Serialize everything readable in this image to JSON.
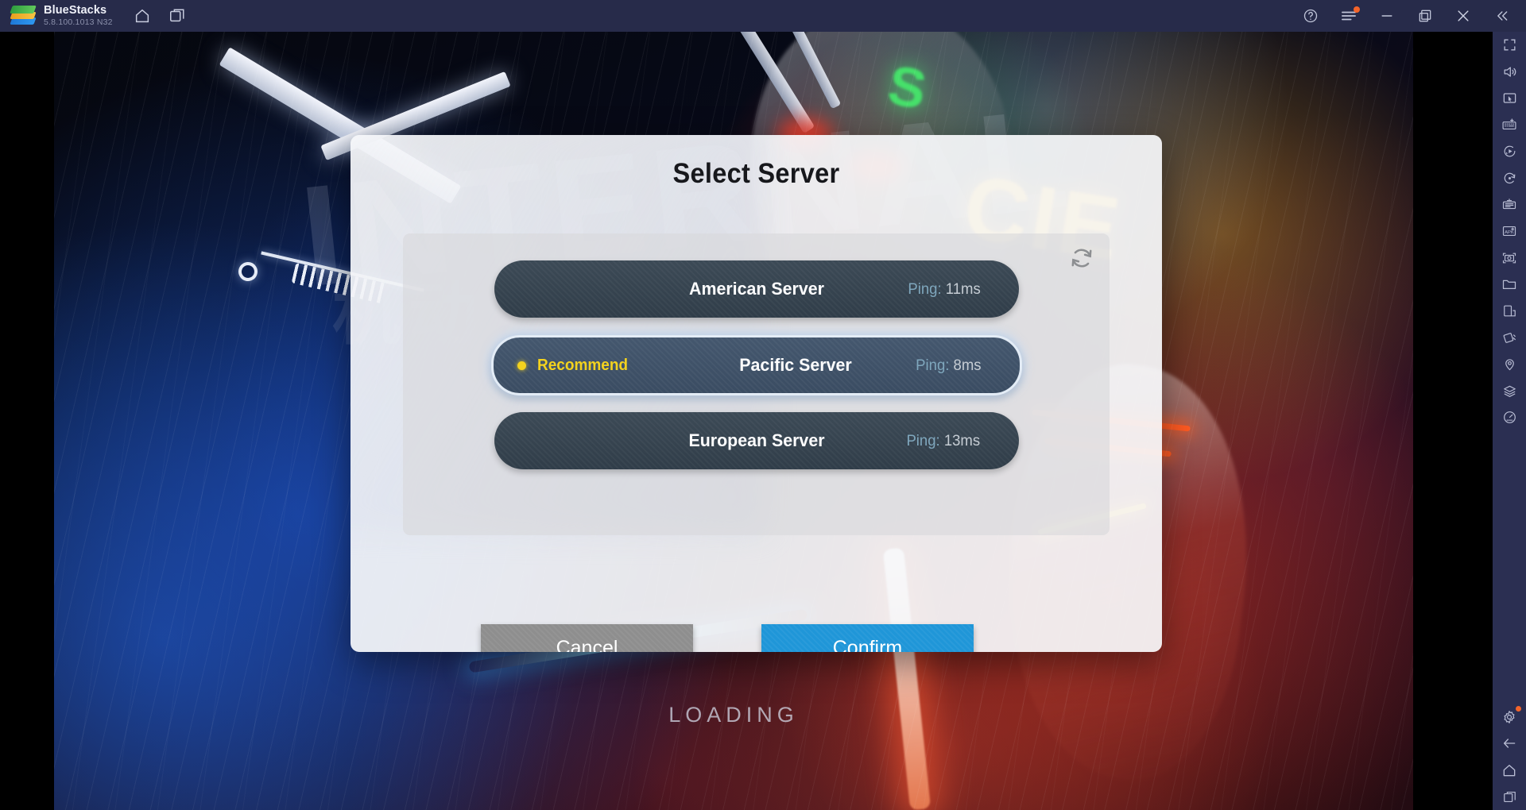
{
  "titlebar": {
    "app_name": "BlueStacks",
    "version": "5.8.100.1013  N32",
    "nav_icons": [
      "home-icon",
      "multi-instance-icon"
    ],
    "window_icons": [
      "help-icon",
      "menu-icon",
      "minimize-icon",
      "maximize-icon",
      "close-icon",
      "collapse-sidebar-icon"
    ],
    "menu_badge": true,
    "bg_color": "#272b4a"
  },
  "game": {
    "loading_text": "LOADING",
    "background_art_text": "INTERNAL",
    "background_cjk": "机动",
    "neon_sign_yellow": "CIE",
    "neon_sign_green": "S"
  },
  "dialog": {
    "title": "Select Server",
    "refresh_icon": "refresh-icon",
    "servers": [
      {
        "name": "American Server",
        "ping_label": "Ping:",
        "ping_value": "11ms",
        "recommended": false,
        "selected": false
      },
      {
        "name": "Pacific Server",
        "ping_label": "Ping:",
        "ping_value": "8ms",
        "recommended": true,
        "selected": true,
        "recommend_label": "Recommend"
      },
      {
        "name": "European Server",
        "ping_label": "Ping:",
        "ping_value": "13ms",
        "recommended": false,
        "selected": false
      }
    ],
    "cancel_label": "Cancel",
    "confirm_label": "Confirm",
    "confirm_color": "#1f96d8",
    "cancel_color": "#8e8e8e",
    "recommend_color": "#f3d21e",
    "selected_border_color": "#e3ecf6"
  },
  "sidebar": {
    "items": [
      "fullscreen-icon",
      "volume-icon",
      "pointer-mode-icon",
      "keyboard-controls-icon",
      "macro-recorder-icon",
      "rotate-icon",
      "multi-instance-manager-icon",
      "install-apk-icon",
      "screenshot-icon",
      "media-folder-icon",
      "copy-instance-icon",
      "shake-icon",
      "location-pin-icon",
      "layers-icon",
      "performance-icon"
    ],
    "bottom_items": [
      "settings-gear-icon",
      "back-icon",
      "home-icon",
      "recents-icon"
    ],
    "settings_badge": true,
    "bg_color": "#2b2f52"
  }
}
